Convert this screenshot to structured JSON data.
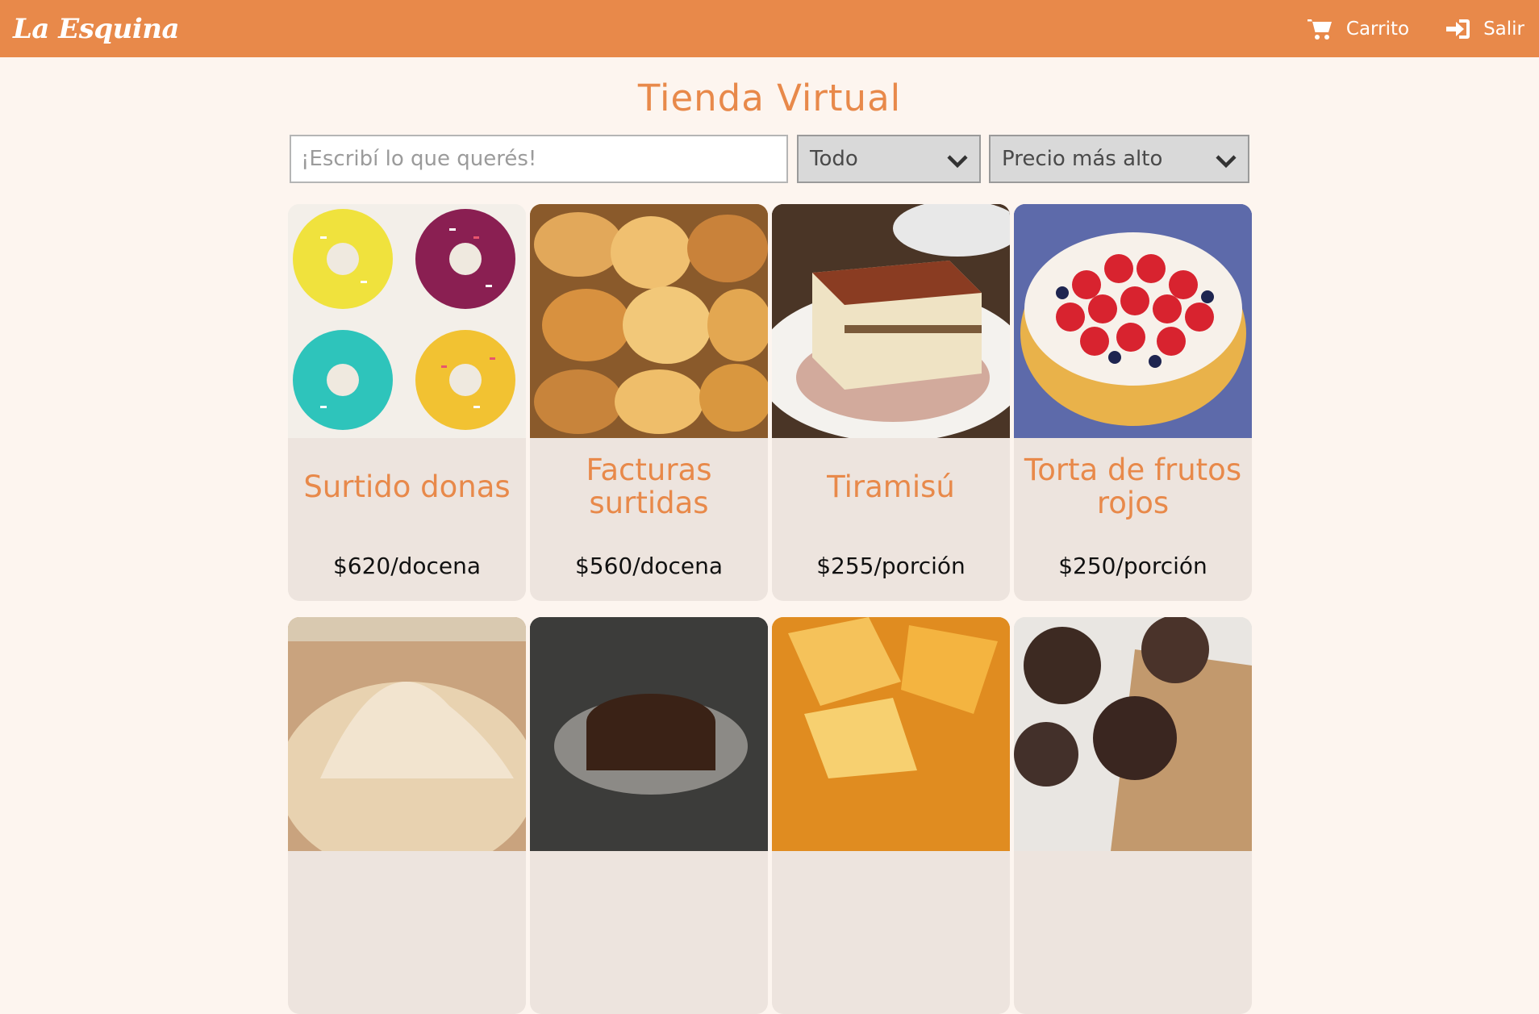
{
  "navbar": {
    "brand": "La Esquina",
    "cart_label": "Carrito",
    "logout_label": "Salir"
  },
  "page": {
    "title": "Tienda Virtual"
  },
  "filters": {
    "search_placeholder": "¡Escribí lo que querés!",
    "category_selected": "Todo",
    "sort_selected": "Precio más alto"
  },
  "products": [
    {
      "name": "Surtido donas",
      "price": "$620/docena"
    },
    {
      "name": "Facturas surtidas",
      "price": "$560/docena"
    },
    {
      "name": "Tiramisú",
      "price": "$255/porción"
    },
    {
      "name": "Torta de frutos rojos",
      "price": "$250/porción"
    }
  ],
  "colors": {
    "accent": "#e8894a",
    "background": "#fdf5ef",
    "card": "#ede4de"
  }
}
